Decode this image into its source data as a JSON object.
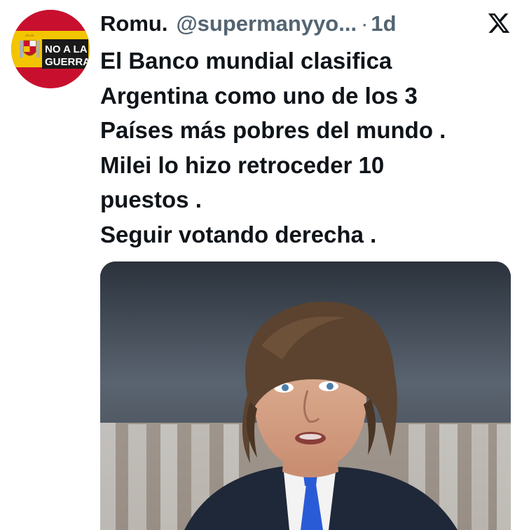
{
  "tweet": {
    "display_name": "Romu.",
    "handle": "@supermanyyo...",
    "separator": "·",
    "time": "1d",
    "lines": [
      "El Banco mundial clasifica",
      "Argentina como uno de los 3",
      "Países más pobres del mundo .",
      "Milei lo hizo retroceder 10",
      "puestos .",
      "Seguir votando derecha ."
    ]
  },
  "avatar": {
    "badge_line1": "NO A LA",
    "badge_line2": "GUERRA",
    "flag_colors": [
      "#c8102e",
      "#f2c500"
    ]
  },
  "icons": {
    "platform": "x-logo-icon"
  },
  "colors": {
    "text": "#0f1419",
    "secondary": "#536471",
    "background": "#ffffff"
  }
}
